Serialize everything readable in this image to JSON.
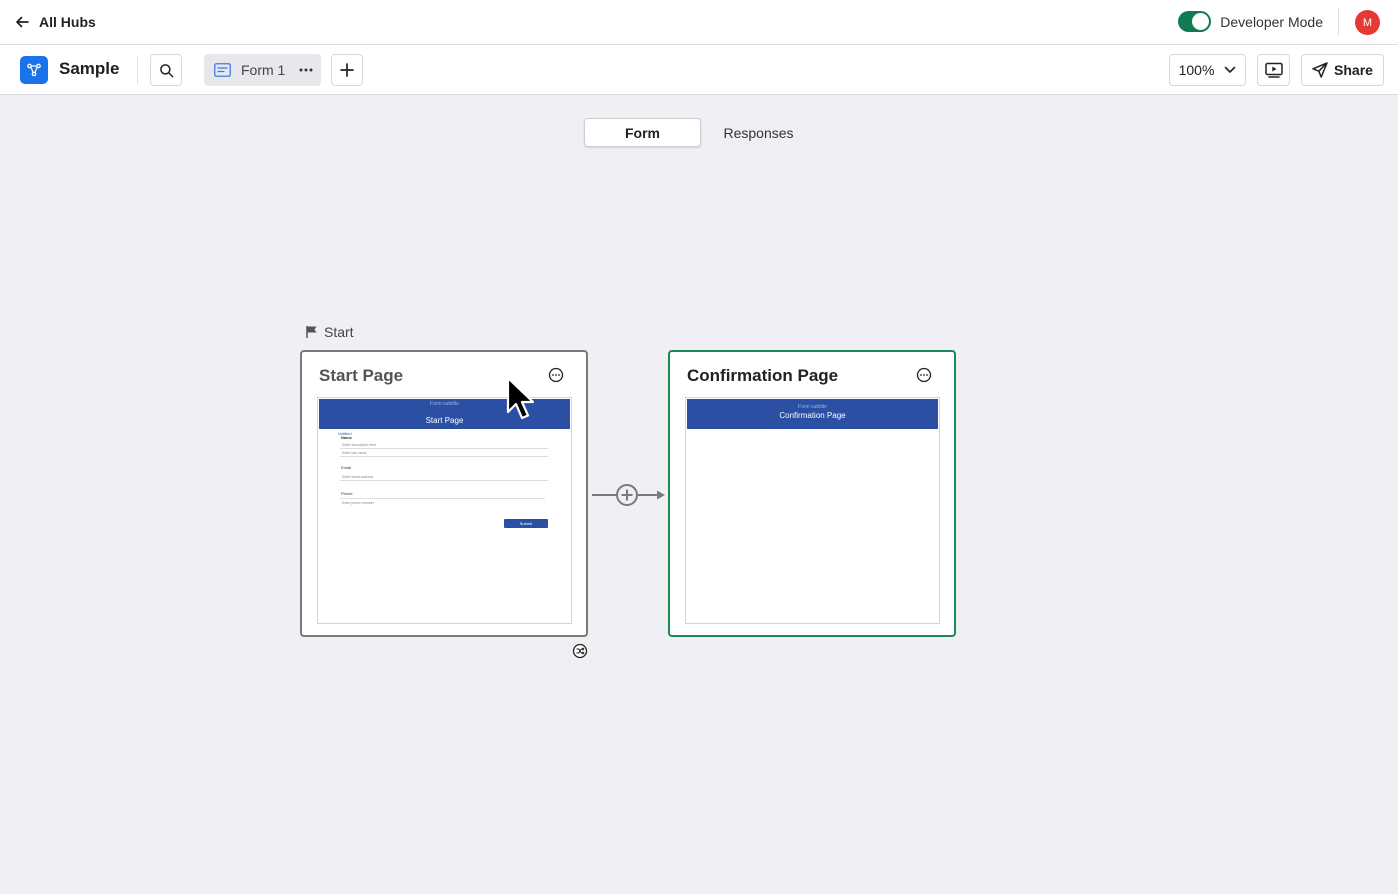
{
  "topbar": {
    "back_label": "All Hubs",
    "developer_mode_label": "Developer Mode",
    "developer_mode_on": true,
    "avatar_initial": "M"
  },
  "toolbar": {
    "app_title": "Sample",
    "form_tab_label": "Form 1",
    "zoom_label": "100%",
    "share_label": "Share"
  },
  "view_tabs": {
    "form_label": "Form",
    "responses_label": "Responses",
    "active": "Form"
  },
  "canvas": {
    "start_label": "Start",
    "start_card": {
      "title": "Start Page",
      "preview": {
        "caption": "Form subtitle",
        "header": "Start Page",
        "section": "Untitled",
        "fields": [
          {
            "label": "Name",
            "placeholder": "Enter description here"
          },
          {
            "label": "",
            "placeholder": "Enter last name"
          },
          {
            "label": "Email",
            "placeholder": "Enter email address"
          },
          {
            "label": "Phone",
            "placeholder": "Enter phone number"
          }
        ],
        "submit_label": "Submit"
      }
    },
    "confirm_card": {
      "title": "Confirmation Page",
      "preview": {
        "caption": "Form subtitle",
        "header": "Confirmation Page"
      }
    }
  },
  "colors": {
    "accent_blue": "#1a73e8",
    "toggle_green": "#117a52",
    "selected_border": "#1b8a5a",
    "form_header_blue": "#2a4fa3",
    "avatar_red": "#e53935"
  }
}
